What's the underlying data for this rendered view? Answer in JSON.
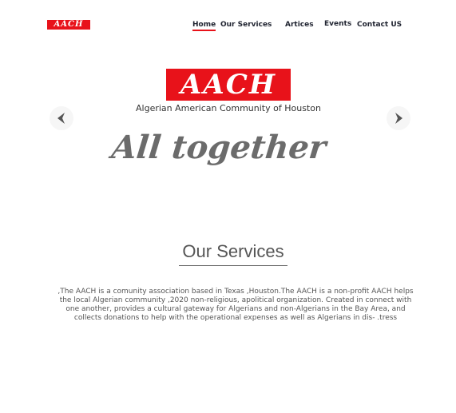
{
  "header": {
    "logo_text": "AACH",
    "nav": [
      {
        "label": "Home",
        "active": true
      },
      {
        "label": "Our Services",
        "active": false
      },
      {
        "label": "Artices",
        "active": false
      },
      {
        "label": "Events",
        "active": false
      },
      {
        "label": "Contact US",
        "active": false
      }
    ]
  },
  "hero": {
    "logo_text": "AACH",
    "subtitle": "Algerian American Community of Houston",
    "tagline": "All together",
    "prev_icon": "chevron-left-icon",
    "next_icon": "chevron-right-icon"
  },
  "services": {
    "title": "Our Services",
    "description": ",The AACH is a comunity association based in Texas ,Houston.The AACH is a non-profit AACH helps the local Algerian community ,2020 non-religious, apolitical organization. Created in connect with one another, provides a cultural gateway for Algerians and non-Algerians in the Bay Area, and collects donations to help with the operational expenses as well as Algerians in dis- .tress"
  },
  "colors": {
    "accent": "#e8121a",
    "text": "#555555",
    "nav_text": "#1f2330"
  }
}
